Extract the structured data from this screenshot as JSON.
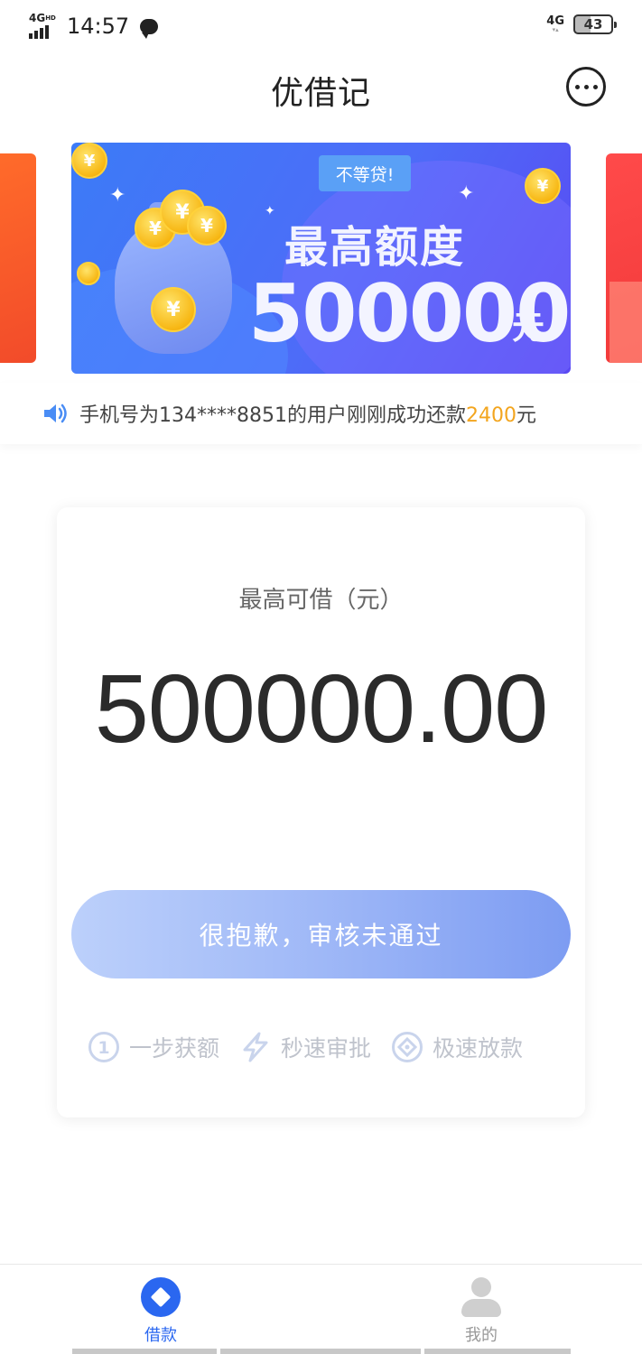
{
  "status_bar": {
    "network": "4G",
    "network_sup": "HD",
    "time": "14:57",
    "right_network": "4G",
    "battery": "43"
  },
  "header": {
    "title": "优借记"
  },
  "banner": {
    "tag": "不等贷!",
    "headline": "最高额度",
    "amount": "500000",
    "unit": "元"
  },
  "notice": {
    "prefix": "手机号为134****8851的用户刚刚成功还款",
    "amount": "2400",
    "suffix": "元"
  },
  "card": {
    "label": "最高可借（元）",
    "amount": "500000.00",
    "button_label": "很抱歉，审核未通过",
    "features": [
      {
        "icon": "step-one-icon",
        "label": "一步获额"
      },
      {
        "icon": "lightning-icon",
        "label": "秒速审批"
      },
      {
        "icon": "diamond-icon",
        "label": "极速放款"
      }
    ]
  },
  "bottom_nav": {
    "items": [
      {
        "icon": "loan-icon",
        "label": "借款",
        "active": true
      },
      {
        "icon": "user-icon",
        "label": "我的",
        "active": false
      }
    ]
  },
  "colors": {
    "accent": "#2a67f0",
    "highlight": "#f3a51e",
    "button_start": "#bcd0fb",
    "button_end": "#7d9cf2"
  }
}
